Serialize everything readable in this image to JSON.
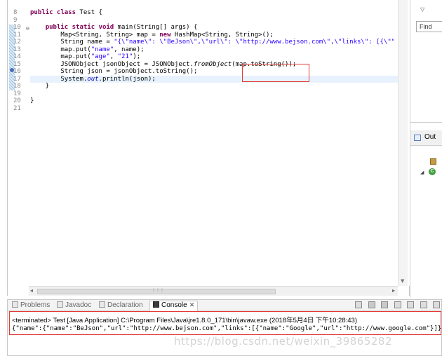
{
  "editor": {
    "line_numbers": [
      "8",
      "9",
      "10",
      "11",
      "12",
      "13",
      "14",
      "15",
      "16",
      "17",
      "18",
      "19",
      "20",
      "21"
    ],
    "lines": [
      [
        {
          "c": "kw",
          "t": "public class "
        },
        {
          "c": "",
          "t": "Test {"
        }
      ],
      [],
      [
        {
          "c": "",
          "t": "    "
        },
        {
          "c": "kw",
          "t": "public static void "
        },
        {
          "c": "",
          "t": "main(String[] args) {"
        }
      ],
      [
        {
          "c": "",
          "t": "        Map<String, String> map = "
        },
        {
          "c": "kw",
          "t": "new "
        },
        {
          "c": "",
          "t": "HashMap<String, String>();"
        }
      ],
      [
        {
          "c": "",
          "t": "        String name = "
        },
        {
          "c": "str",
          "t": "\"{\\\"name\\\": \\\"BeJson\\\",\\\"url\\\": \\\"http://www.bejson.com\\\",\\\"links\\\": [{\\\"\""
        }
      ],
      [
        {
          "c": "",
          "t": "        map.put("
        },
        {
          "c": "str",
          "t": "\"name\""
        },
        {
          "c": "",
          "t": ", name);"
        }
      ],
      [
        {
          "c": "",
          "t": "        map.put("
        },
        {
          "c": "str",
          "t": "\"age\""
        },
        {
          "c": "",
          "t": ", "
        },
        {
          "c": "str",
          "t": "\"21\""
        },
        {
          "c": "",
          "t": ");"
        }
      ],
      [
        {
          "c": "",
          "t": "        JSONObject jsonObject = JSONObject."
        },
        {
          "c": "it",
          "t": "fromObject"
        },
        {
          "c": "",
          "t": "(map.toString());"
        }
      ],
      [
        {
          "c": "",
          "t": "        String json = jsonObject.toString();"
        }
      ],
      [
        {
          "c": "",
          "t": "        System."
        },
        {
          "c": "fld",
          "t": "out"
        },
        {
          "c": "",
          "t": ".println(json);"
        }
      ],
      [
        {
          "c": "",
          "t": "    }"
        }
      ],
      [],
      [
        {
          "c": "",
          "t": "}"
        }
      ],
      []
    ]
  },
  "right_panel": {
    "find_label": "Find",
    "outline_label": "Out"
  },
  "bottom_panel": {
    "tabs": [
      {
        "label": "Problems"
      },
      {
        "label": "Javadoc"
      },
      {
        "label": "Declaration"
      },
      {
        "label": "Console",
        "active": true
      }
    ],
    "console": {
      "terminated_line": "<terminated> Test [Java Application] C:\\Program Files\\Java\\jre1.8.0_171\\bin\\javaw.exe (2018年5月4日 下午10:28:43)",
      "output_line": "{\"name\":{\"name\":\"BeJson\",\"url\":\"http://www.bejson.com\",\"links\":[{\"name\":\"Google\",\"url\":\"http://www.google.com\"}]}"
    }
  },
  "watermark": "https://blog.csdn.net/weixin_39865282",
  "colors": {
    "keyword": "#7f0055",
    "string": "#2a00ff",
    "field": "#0000c0",
    "highlight_box": "#e53935",
    "current_line": "#e8f2fe"
  }
}
